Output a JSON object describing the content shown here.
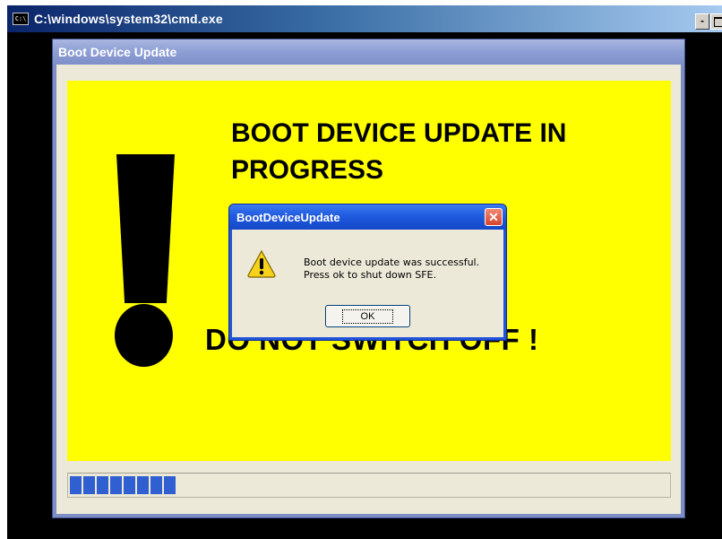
{
  "cmd": {
    "title": "C:\\windows\\system32\\cmd.exe",
    "icon_text": "C:\\",
    "minimize_symbol": "-"
  },
  "app": {
    "title": "Boot Device Update",
    "heading": "BOOT DEVICE UPDATE IN PROGRESS",
    "warning": "DO NOT SWITCH OFF !",
    "progress_segments_filled": 8
  },
  "dialog": {
    "title": "BootDeviceUpdate",
    "close_symbol": "✕",
    "message_lines": [
      "Boot device update was successful.",
      "Press ok to shut down SFE."
    ],
    "ok_label": "OK"
  },
  "colors": {
    "panel_yellow": "#ffff00",
    "progress_blue": "#2f5fd0",
    "xp_blue": "#2154d8"
  }
}
